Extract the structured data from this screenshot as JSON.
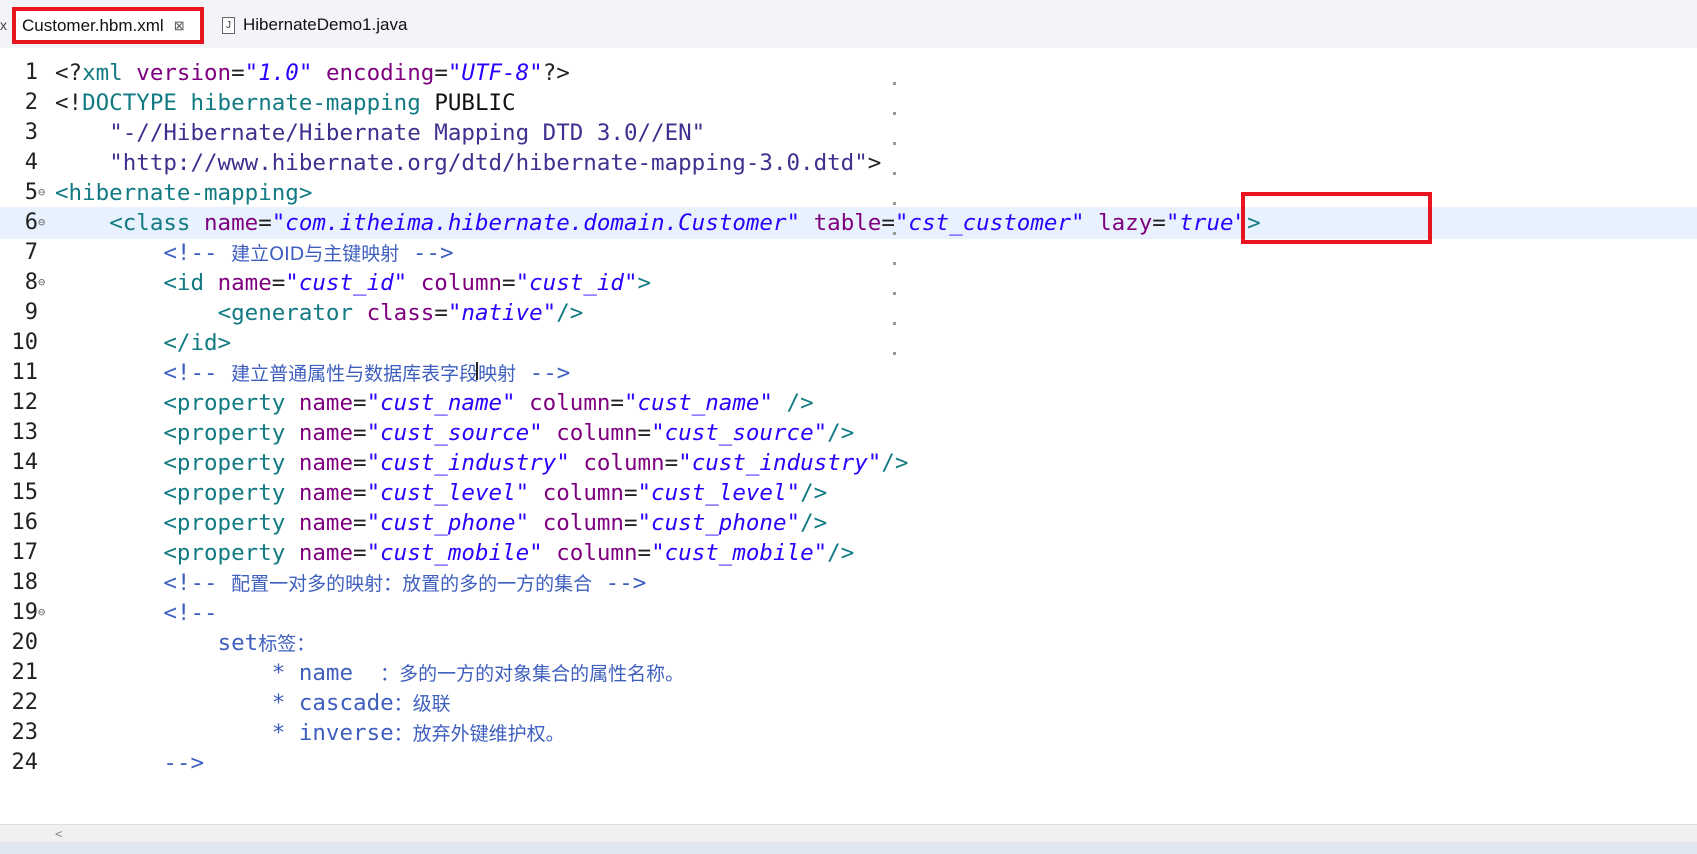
{
  "tabs": [
    {
      "label": "Customer.hbm.xml",
      "active": true,
      "close": "⊠"
    },
    {
      "label": "HibernateDemo1.java",
      "active": false
    }
  ],
  "tab_left_edge": "x",
  "editor": {
    "lines": [
      {
        "num": "1",
        "fold": "",
        "current": false,
        "tokens": [
          [
            "p",
            "<?"
          ],
          [
            "t",
            "xml"
          ],
          [
            "p",
            " "
          ],
          [
            "a",
            "version"
          ],
          [
            "p",
            "="
          ],
          [
            "v",
            "\"1.0\""
          ],
          [
            "p",
            " "
          ],
          [
            "a",
            "encoding"
          ],
          [
            "p",
            "="
          ],
          [
            "v",
            "\"UTF-8\""
          ],
          [
            "p",
            "?>"
          ]
        ]
      },
      {
        "num": "2",
        "fold": "",
        "current": false,
        "tokens": [
          [
            "p",
            "<!"
          ],
          [
            "t",
            "DOCTYPE"
          ],
          [
            "p",
            " "
          ],
          [
            "t",
            "hibernate-mapping"
          ],
          [
            "p",
            " "
          ],
          [
            "plain",
            "PUBLIC"
          ]
        ]
      },
      {
        "num": "3",
        "fold": "",
        "current": false,
        "tokens": [
          [
            "p",
            "    "
          ],
          [
            "n",
            "\"-//Hibernate/Hibernate Mapping DTD 3.0//EN\""
          ]
        ]
      },
      {
        "num": "4",
        "fold": "",
        "current": false,
        "tokens": [
          [
            "p",
            "    "
          ],
          [
            "n",
            "\"http://www.hibernate.org/dtd/hibernate-mapping-3.0.dtd\""
          ],
          [
            "p",
            ">"
          ]
        ]
      },
      {
        "num": "5",
        "fold": "⊖",
        "current": false,
        "tokens": [
          [
            "t",
            "<hibernate-mapping>"
          ]
        ]
      },
      {
        "num": "6",
        "fold": "⊖",
        "current": true,
        "tokens": [
          [
            "p",
            "    "
          ],
          [
            "t",
            "<class"
          ],
          [
            "p",
            " "
          ],
          [
            "a",
            "name"
          ],
          [
            "p",
            "="
          ],
          [
            "v",
            "\"com.itheima.hibernate.domain.Customer\""
          ],
          [
            "p",
            " "
          ],
          [
            "a",
            "table"
          ],
          [
            "p",
            "="
          ],
          [
            "v",
            "\"cst_customer\""
          ],
          [
            "p",
            " "
          ],
          [
            "a",
            "lazy"
          ],
          [
            "p",
            "="
          ],
          [
            "v",
            "\"true\""
          ],
          [
            "t",
            ">"
          ]
        ]
      },
      {
        "num": "7",
        "fold": "",
        "current": false,
        "tokens": [
          [
            "p",
            "        "
          ],
          [
            "cm",
            "<!-- "
          ],
          [
            "cmz",
            "建立OID与主键映射"
          ],
          [
            "cm",
            " -->"
          ]
        ]
      },
      {
        "num": "8",
        "fold": "⊖",
        "current": false,
        "tokens": [
          [
            "p",
            "        "
          ],
          [
            "t",
            "<id"
          ],
          [
            "p",
            " "
          ],
          [
            "a",
            "name"
          ],
          [
            "p",
            "="
          ],
          [
            "v",
            "\"cust_id\""
          ],
          [
            "p",
            " "
          ],
          [
            "a",
            "column"
          ],
          [
            "p",
            "="
          ],
          [
            "v",
            "\"cust_id\""
          ],
          [
            "t",
            ">"
          ]
        ]
      },
      {
        "num": "9",
        "fold": "",
        "current": false,
        "tokens": [
          [
            "p",
            "            "
          ],
          [
            "t",
            "<generator"
          ],
          [
            "p",
            " "
          ],
          [
            "a",
            "class"
          ],
          [
            "p",
            "="
          ],
          [
            "v",
            "\"native\""
          ],
          [
            "t",
            "/>"
          ]
        ]
      },
      {
        "num": "10",
        "fold": "",
        "current": false,
        "tokens": [
          [
            "p",
            "        "
          ],
          [
            "t",
            "</id>"
          ]
        ]
      },
      {
        "num": "11",
        "fold": "",
        "current": false,
        "tokens": [
          [
            "p",
            "        "
          ],
          [
            "cm",
            "<!-- "
          ],
          [
            "cmz",
            "建立普通属性与数据库表字段映射"
          ],
          [
            "cm",
            " -->"
          ]
        ]
      },
      {
        "num": "12",
        "fold": "",
        "current": false,
        "tokens": [
          [
            "p",
            "        "
          ],
          [
            "t",
            "<property"
          ],
          [
            "p",
            " "
          ],
          [
            "a",
            "name"
          ],
          [
            "p",
            "="
          ],
          [
            "v",
            "\"cust_name\""
          ],
          [
            "p",
            " "
          ],
          [
            "a",
            "column"
          ],
          [
            "p",
            "="
          ],
          [
            "v",
            "\"cust_name\""
          ],
          [
            "p",
            " "
          ],
          [
            "t",
            "/>"
          ]
        ]
      },
      {
        "num": "13",
        "fold": "",
        "current": false,
        "tokens": [
          [
            "p",
            "        "
          ],
          [
            "t",
            "<property"
          ],
          [
            "p",
            " "
          ],
          [
            "a",
            "name"
          ],
          [
            "p",
            "="
          ],
          [
            "v",
            "\"cust_source\""
          ],
          [
            "p",
            " "
          ],
          [
            "a",
            "column"
          ],
          [
            "p",
            "="
          ],
          [
            "v",
            "\"cust_source\""
          ],
          [
            "t",
            "/>"
          ]
        ]
      },
      {
        "num": "14",
        "fold": "",
        "current": false,
        "tokens": [
          [
            "p",
            "        "
          ],
          [
            "t",
            "<property"
          ],
          [
            "p",
            " "
          ],
          [
            "a",
            "name"
          ],
          [
            "p",
            "="
          ],
          [
            "v",
            "\"cust_industry\""
          ],
          [
            "p",
            " "
          ],
          [
            "a",
            "column"
          ],
          [
            "p",
            "="
          ],
          [
            "v",
            "\"cust_industry\""
          ],
          [
            "t",
            "/>"
          ]
        ]
      },
      {
        "num": "15",
        "fold": "",
        "current": false,
        "tokens": [
          [
            "p",
            "        "
          ],
          [
            "t",
            "<property"
          ],
          [
            "p",
            " "
          ],
          [
            "a",
            "name"
          ],
          [
            "p",
            "="
          ],
          [
            "v",
            "\"cust_level\""
          ],
          [
            "p",
            " "
          ],
          [
            "a",
            "column"
          ],
          [
            "p",
            "="
          ],
          [
            "v",
            "\"cust_level\""
          ],
          [
            "t",
            "/>"
          ]
        ]
      },
      {
        "num": "16",
        "fold": "",
        "current": false,
        "tokens": [
          [
            "p",
            "        "
          ],
          [
            "t",
            "<property"
          ],
          [
            "p",
            " "
          ],
          [
            "a",
            "name"
          ],
          [
            "p",
            "="
          ],
          [
            "v",
            "\"cust_phone\""
          ],
          [
            "p",
            " "
          ],
          [
            "a",
            "column"
          ],
          [
            "p",
            "="
          ],
          [
            "v",
            "\"cust_phone\""
          ],
          [
            "t",
            "/>"
          ]
        ]
      },
      {
        "num": "17",
        "fold": "",
        "current": false,
        "tokens": [
          [
            "p",
            "        "
          ],
          [
            "t",
            "<property"
          ],
          [
            "p",
            " "
          ],
          [
            "a",
            "name"
          ],
          [
            "p",
            "="
          ],
          [
            "v",
            "\"cust_mobile\""
          ],
          [
            "p",
            " "
          ],
          [
            "a",
            "column"
          ],
          [
            "p",
            "="
          ],
          [
            "v",
            "\"cust_mobile\""
          ],
          [
            "t",
            "/>"
          ]
        ]
      },
      {
        "num": "18",
        "fold": "",
        "current": false,
        "tokens": [
          [
            "p",
            "        "
          ],
          [
            "cm",
            "<!-- "
          ],
          [
            "cmz",
            "配置一对多的映射：放置的多的一方的集合"
          ],
          [
            "cm",
            " -->"
          ]
        ]
      },
      {
        "num": "19",
        "fold": "⊖",
        "current": false,
        "tokens": [
          [
            "p",
            "        "
          ],
          [
            "cm",
            "<!--"
          ]
        ]
      },
      {
        "num": "20",
        "fold": "",
        "current": false,
        "tokens": [
          [
            "p",
            "            "
          ],
          [
            "cm",
            "set"
          ],
          [
            "cmz",
            "标签："
          ]
        ]
      },
      {
        "num": "21",
        "fold": "",
        "current": false,
        "tokens": [
          [
            "p",
            "                "
          ],
          [
            "cm",
            "* name  "
          ],
          [
            "cmz",
            "：多的一方的对象集合的属性名称。"
          ]
        ]
      },
      {
        "num": "22",
        "fold": "",
        "current": false,
        "tokens": [
          [
            "p",
            "                "
          ],
          [
            "cm",
            "* cascade"
          ],
          [
            "cmz",
            "：级联"
          ]
        ]
      },
      {
        "num": "23",
        "fold": "",
        "current": false,
        "tokens": [
          [
            "p",
            "                "
          ],
          [
            "cm",
            "* inverse"
          ],
          [
            "cmz",
            "：放弃外键维护权。"
          ]
        ]
      },
      {
        "num": "24",
        "fold": "",
        "current": false,
        "tokens": [
          [
            "p",
            "        "
          ],
          [
            "cm",
            "-->"
          ]
        ]
      }
    ]
  },
  "scroll_arrow": "<"
}
